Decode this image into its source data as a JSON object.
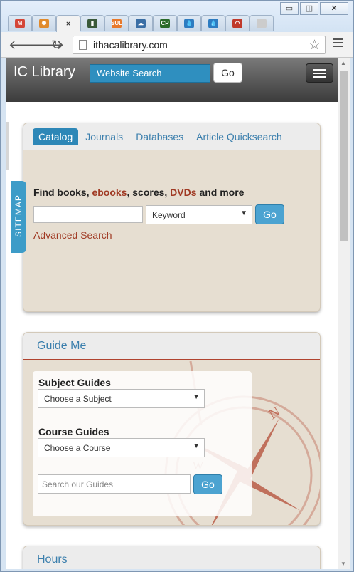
{
  "browser": {
    "window_controls": {
      "minimize": "▭",
      "maximize": "◫",
      "close": "✕"
    },
    "tabs": [
      {
        "name": "gmail",
        "glyph": "M",
        "color": "#d44638",
        "active": false
      },
      {
        "name": "wheel",
        "glyph": "✺",
        "color": "#e08a2c",
        "active": false
      },
      {
        "name": "current",
        "glyph": "✕",
        "color": "#333333",
        "active": true
      },
      {
        "name": "book",
        "glyph": "▮",
        "color": "#3a5a3a",
        "active": false
      },
      {
        "name": "sul",
        "glyph": "SUL",
        "color": "#e8792b",
        "active": false
      },
      {
        "name": "cloud",
        "glyph": "☁",
        "color": "#3a6ea5",
        "active": false
      },
      {
        "name": "cp",
        "glyph": "CP",
        "color": "#2a6b2a",
        "active": false
      },
      {
        "name": "drupal1",
        "glyph": "💧",
        "color": "#2d7cc1",
        "active": false
      },
      {
        "name": "drupal2",
        "glyph": "💧",
        "color": "#2d7cc1",
        "active": false
      },
      {
        "name": "arc",
        "glyph": "◠",
        "color": "#c0392b",
        "active": false
      },
      {
        "name": "blank",
        "glyph": "",
        "color": "#cccccc",
        "active": false
      }
    ],
    "url": "ithacalibrary.com"
  },
  "site": {
    "brand": "IC Library",
    "search_label": "Website Search",
    "go": "Go",
    "sitemap": "SITEMAP"
  },
  "catalog": {
    "tabs": [
      "Catalog",
      "Journals",
      "Databases",
      "Article Quicksearch"
    ],
    "find_parts": [
      "Find books, ",
      "ebooks",
      ", scores, ",
      "DVDs",
      " and more"
    ],
    "search_value": "",
    "search_type": "Keyword",
    "go": "Go",
    "advanced": "Advanced Search"
  },
  "guide": {
    "title": "Guide Me",
    "subject_label": "Subject Guides",
    "subject_select": "Choose a Subject",
    "course_label": "Course Guides",
    "course_select": "Choose a Course",
    "search_placeholder": "Search our Guides",
    "go": "Go"
  },
  "hours": {
    "title": "Hours"
  },
  "colors": {
    "accent": "#2d87b7",
    "red": "#a03a24",
    "panel": "#e6ded1"
  }
}
